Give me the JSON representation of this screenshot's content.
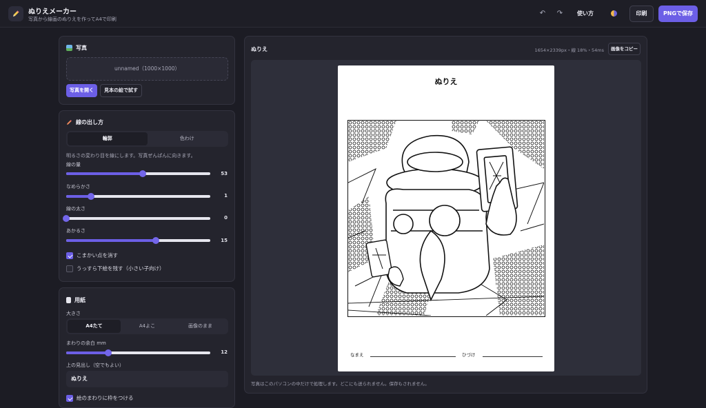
{
  "header": {
    "title": "ぬりえメーカー",
    "subtitle": "写真から線画のぬりえを作ってA4で印刷",
    "help_label": "使い方",
    "print_label": "印刷",
    "save_label": "PNGで保存"
  },
  "photo_panel": {
    "title": "写真",
    "dropzone_text": "unnamed（1000×1000）",
    "open_label": "写真を開く",
    "sample_label": "見本の絵で試す"
  },
  "line_panel": {
    "title": "線の出し方",
    "modes": [
      "輪郭",
      "色わけ"
    ],
    "active_mode": "輪郭",
    "description": "明るさの変わり目を線にします。写真ぜんぱんに向きます。",
    "sliders": [
      {
        "label": "線の量",
        "value": 53,
        "fraction": 0.53
      },
      {
        "label": "なめらかさ",
        "value": 1,
        "fraction": 0.17
      },
      {
        "label": "線の太さ",
        "value": 0,
        "fraction": 0.0
      },
      {
        "label": "あかるさ",
        "value": 15,
        "fraction": 0.62
      }
    ],
    "checkboxes": [
      {
        "label": "こまかい点を消す",
        "checked": true
      },
      {
        "label": "うっすら下絵を残す（小さい子向け）",
        "checked": false
      }
    ]
  },
  "paper_panel": {
    "title": "用紙",
    "size_label": "大きさ",
    "sizes": [
      "A4たて",
      "A4よこ",
      "画像のまま"
    ],
    "active_size": "A4たて",
    "margin_label": "まわりの余白 mm",
    "margin_value": 12,
    "margin_fraction": 0.29,
    "heading_label": "上の見出し（空でもよい）",
    "heading_value": "ぬりえ",
    "frame_checkbox_label": "絵のまわりに枠をつける",
    "frame_checked": true
  },
  "preview": {
    "title": "ぬりえ",
    "meta": "1654×2339px・線 18%・54ms",
    "copy_label": "画像をコピー",
    "sheet_title": "ぬりえ",
    "name_label": "なまえ",
    "date_label": "ひづけ",
    "privacy_note": "写真はこのパソコンの中だけで処理します。どこにも送られません。保存もされません。"
  },
  "colors": {
    "accent": "#6c5fe6",
    "background": "#1c1c24",
    "panel": "#24242d"
  }
}
